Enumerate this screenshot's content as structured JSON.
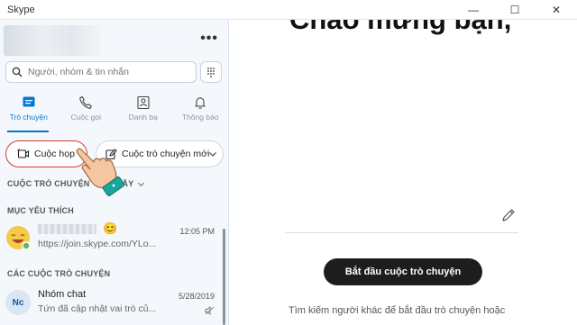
{
  "window": {
    "title": "Skype",
    "controls": [
      "—",
      "☐",
      "✕"
    ]
  },
  "sidebar": {
    "more_label": "•••",
    "search": {
      "placeholder": "Người, nhóm & tin nhắn"
    },
    "tabs": [
      {
        "label": "Trò chuyện",
        "icon": "chat-icon",
        "active": true
      },
      {
        "label": "Cuộc gọi",
        "icon": "phone-icon",
        "active": false
      },
      {
        "label": "Danh bạ",
        "icon": "contacts-icon",
        "active": false
      },
      {
        "label": "Thông báo",
        "icon": "bell-icon",
        "active": false
      }
    ],
    "meet_button": "Cuộc họp",
    "new_chat_button": "Cuộc trò chuyện mới",
    "recent_header": "CUỘC TRÒ CHUYỆN",
    "recent_header_tail": "ẦY",
    "favorites_header": "MỤC YÊU THÍCH",
    "favorites": [
      {
        "snippet": "https://join.skype.com/YLo...",
        "date": "12:05 PM"
      }
    ],
    "chats_header": "CÁC CUỘC TRÒ CHUYỆN",
    "chats": [
      {
        "initials": "Nc",
        "name": "Nhóm chat",
        "snippet": "Tứn đã cập nhật vai trò củ...",
        "date": "5/28/2019"
      }
    ]
  },
  "main": {
    "welcome": "Chào mừng bạn,",
    "start_button": "Bắt đầu cuộc trò chuyện",
    "hint": "Tìm kiếm người khác để bắt đầu trò chuyện hoặc"
  },
  "colors": {
    "accent": "#0078d4",
    "highlight_border": "#d03a3a",
    "start_button_bg": "#1c1d1f",
    "sidebar_bg": "#f4f8fc"
  }
}
